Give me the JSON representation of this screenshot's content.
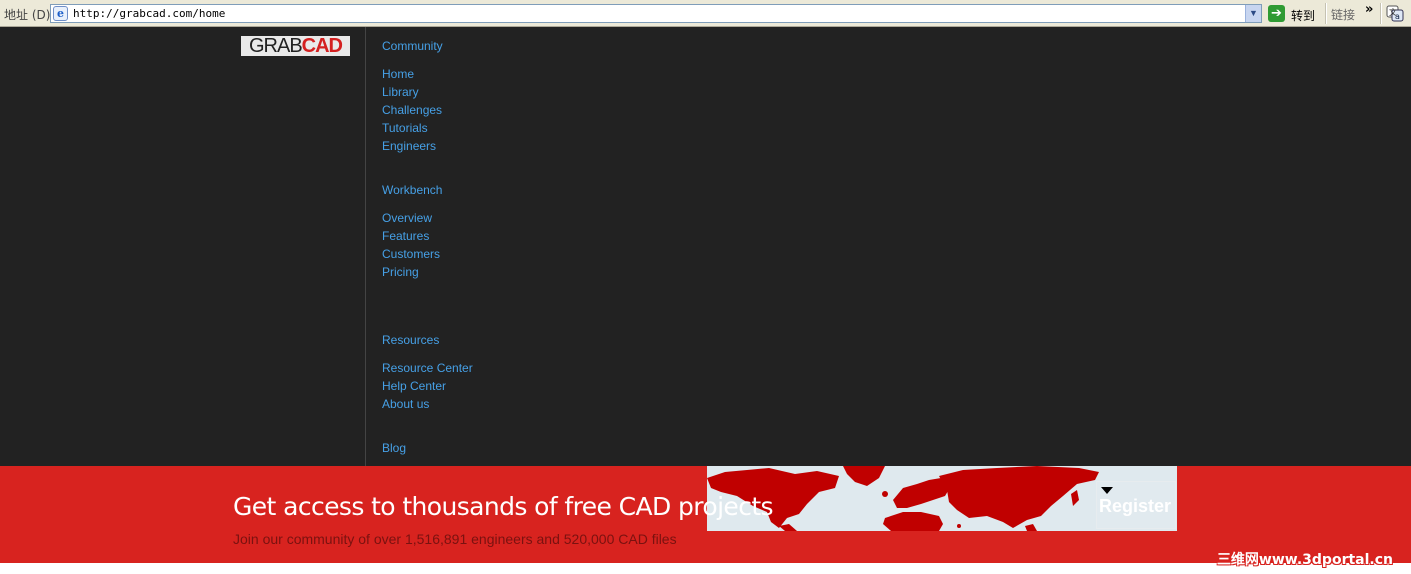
{
  "browser": {
    "address_label": "地址 (D)",
    "url": "http://grabcad.com/home",
    "go_label": "转到",
    "links_label": "链接",
    "links_chevron": "»",
    "icons": [
      "ie-page-icon",
      "dropdown-arrow-icon",
      "go-arrow-icon",
      "chevron-icon",
      "translate-icon"
    ]
  },
  "logo": {
    "grab": "GRAB",
    "cad": "CAD"
  },
  "nav": {
    "community": {
      "heading": "Community",
      "links": [
        "Home",
        "Library",
        "Challenges",
        "Tutorials",
        "Engineers"
      ]
    },
    "workbench": {
      "heading": "Workbench",
      "links": [
        "Overview",
        "Features",
        "Customers",
        "Pricing"
      ]
    },
    "resources": {
      "heading": "Resources",
      "links": [
        "Resource Center",
        "Help Center",
        "About us"
      ]
    },
    "blog": "Blog"
  },
  "banner": {
    "title": "Get access to thousands of free CAD projects",
    "subtitle": "Join our community of over 1,516,891 engineers and 520,000 CAD files",
    "register_label": "Register"
  },
  "watermark": "三维网www.3dportal.cn",
  "colors": {
    "page_bg": "#222222",
    "link": "#46a0e6",
    "banner_red": "#d8231f",
    "map_land": "#c00000",
    "map_sea": "#dfe9ee"
  }
}
